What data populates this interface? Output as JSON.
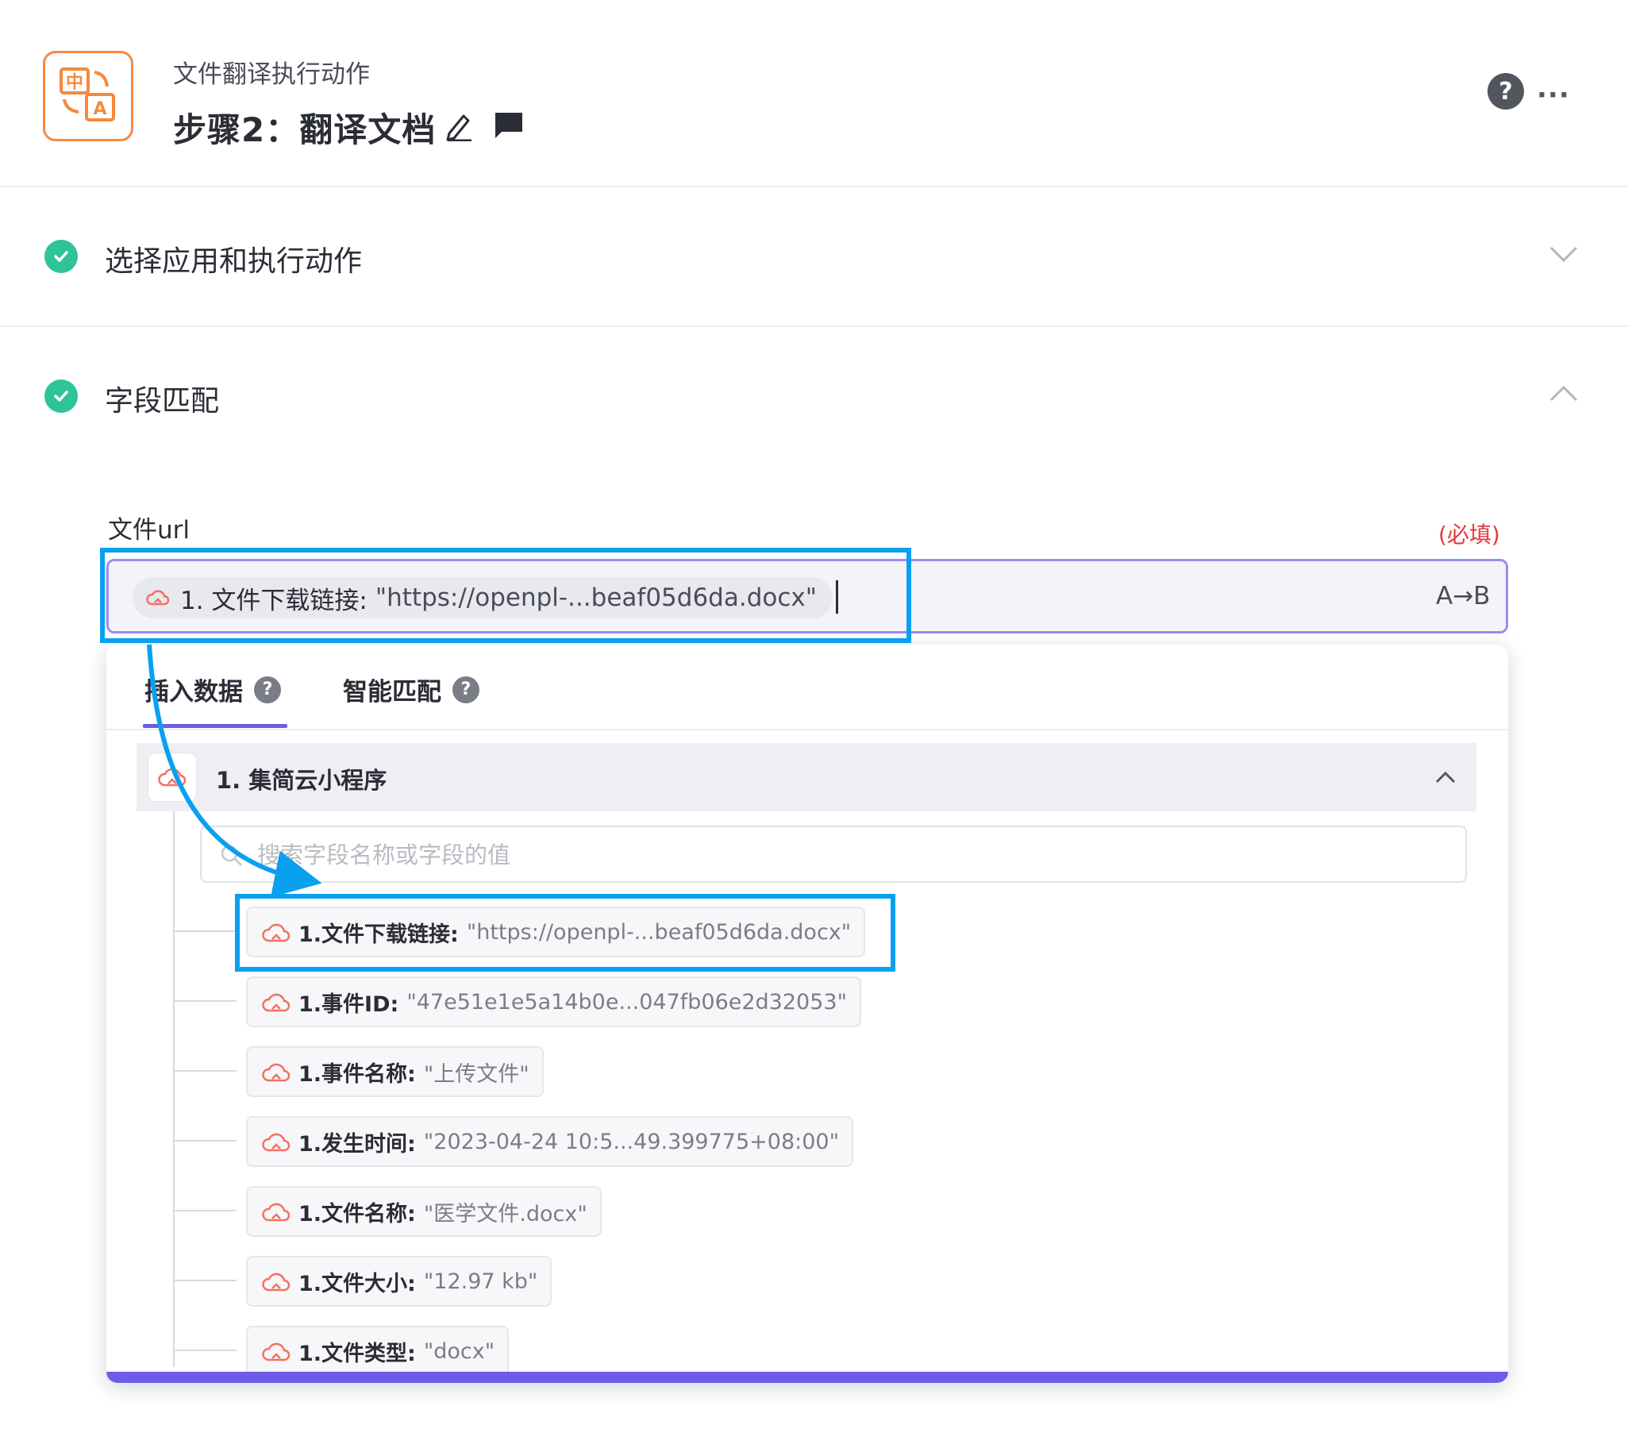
{
  "header": {
    "subtitle": "文件翻译执行动作",
    "title": "步骤2：翻译文档",
    "help_symbol": "?",
    "more_symbol": "···"
  },
  "sections": {
    "app_and_action": {
      "label": "选择应用和执行动作",
      "status": "complete",
      "expanded": false
    },
    "field_mapping": {
      "label": "字段匹配",
      "status": "complete",
      "expanded": true
    }
  },
  "field": {
    "label": "文件url",
    "required_text": "(必填)",
    "token_key": "1. 文件下载链接:",
    "token_value": "\"https://openpl-...beaf05d6da.docx\"",
    "mode_button": "A→B"
  },
  "dropdown": {
    "tabs": {
      "insert": "插入数据",
      "smart": "智能匹配",
      "help_symbol": "?"
    },
    "group": {
      "label": "1. 集简云小程序",
      "expanded": true
    },
    "search": {
      "placeholder": "搜索字段名称或字段的值"
    },
    "items": [
      {
        "key": "1.文件下载链接:",
        "value": "\"https://openpl-...beaf05d6da.docx\"",
        "highlighted": true
      },
      {
        "key": "1.事件ID:",
        "value": "\"47e51e1e5a14b0e...047fb06e2d32053\""
      },
      {
        "key": "1.事件名称:",
        "value": "\"上传文件\""
      },
      {
        "key": "1.发生时间:",
        "value": "\"2023-04-24 10:5...49.399775+08:00\""
      },
      {
        "key": "1.文件名称:",
        "value": "\"医学文件.docx\""
      },
      {
        "key": "1.文件大小:",
        "value": "\"12.97 kb\""
      },
      {
        "key": "1.文件类型:",
        "value": "\"docx\""
      }
    ]
  },
  "colors": {
    "accent": "#6c5ce7",
    "check": "#2fc39a",
    "app_icon": "#f58a3c",
    "annotation": "#0aa0f0",
    "required": "#e8383b"
  },
  "icons": {
    "app": "translate-icon",
    "cloud": "cloud-icon",
    "check": "check-circle-icon"
  }
}
